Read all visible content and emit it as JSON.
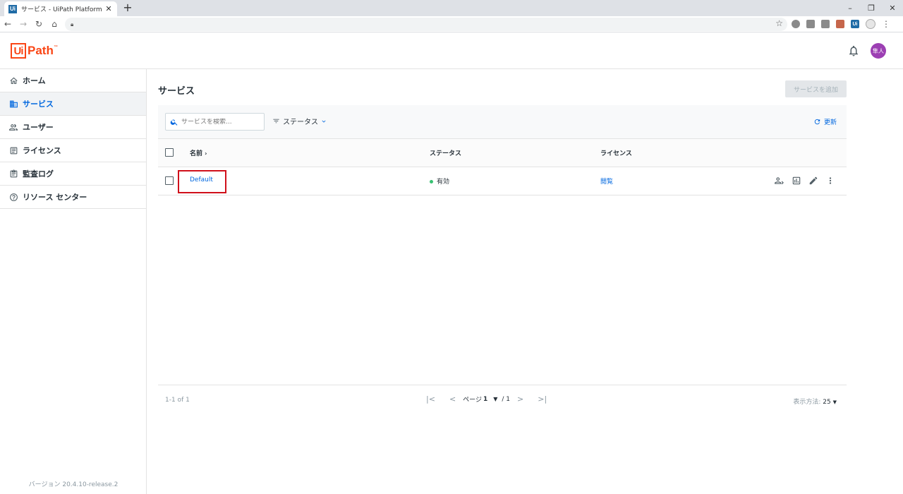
{
  "browser": {
    "tab_title": "サービス - UiPath Platform",
    "favicon": "Ui",
    "new_tab": "+",
    "close": "✕"
  },
  "app": {
    "logo_box": "Ui",
    "logo_text": "Path",
    "logo_tm": "™",
    "avatar": "隼人",
    "accent": "#fa4616"
  },
  "sidebar": {
    "items": [
      {
        "label": "ホーム",
        "icon": "home-icon"
      },
      {
        "label": "サービス",
        "icon": "building-icon",
        "active": true
      },
      {
        "label": "ユーザー",
        "icon": "users-icon"
      },
      {
        "label": "ライセンス",
        "icon": "license-icon"
      },
      {
        "label": "監査ログ",
        "icon": "audit-log-icon"
      },
      {
        "label": "リソース センター",
        "icon": "help-icon"
      }
    ],
    "version": "バージョン 20.4.10-release.2"
  },
  "main": {
    "title": "サービス",
    "add_button": "サービスを追加",
    "search_placeholder": "サービスを検索...",
    "status_filter": "ステータス",
    "refresh": "更新",
    "columns": {
      "name": "名前",
      "status": "ステータス",
      "license": "ライセンス"
    },
    "rows": [
      {
        "name": "Default",
        "status": "有効",
        "license": "閲覧"
      }
    ],
    "footer": {
      "range": "1-1 of 1",
      "page_label": "ページ",
      "page": "1",
      "total": "/ 1",
      "per_page_label": "表示方法:",
      "per_page": "25"
    }
  }
}
